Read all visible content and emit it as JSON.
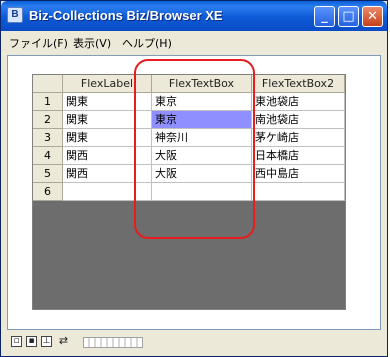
{
  "window": {
    "title": "Biz-Collections Biz/Browser XE",
    "app_icon_glyph": "B",
    "icon": "app-window-icon",
    "buttons": {
      "minimize": "_",
      "maximize": "□",
      "close": "✕"
    }
  },
  "menu": {
    "items": [
      "ファイル(F)",
      "表示(V)",
      "ヘルプ(H)"
    ]
  },
  "grid": {
    "columns": [
      "",
      "FlexLabel",
      "FlexTextBox",
      "FlexTextBox2"
    ],
    "rows": [
      {
        "num": "1",
        "label": "関東",
        "text": "東京",
        "text2": "東池袋店"
      },
      {
        "num": "2",
        "label": "関東",
        "text": "東京",
        "text2": "南池袋店"
      },
      {
        "num": "3",
        "label": "関東",
        "text": "神奈川",
        "text2": "茅ケ崎店"
      },
      {
        "num": "4",
        "label": "関西",
        "text": "大阪",
        "text2": "日本橋店"
      },
      {
        "num": "5",
        "label": "関西",
        "text": "大阪",
        "text2": "西中島店"
      },
      {
        "num": "6",
        "label": "",
        "text": "",
        "text2": ""
      }
    ],
    "selected_cell": {
      "row": 2,
      "column": "FlexTextBox"
    },
    "colors": {
      "selection": "#8f8fff",
      "empty_area": "#6d6d6d",
      "annotation": "#e81c1c"
    }
  },
  "statusbar": {
    "icons": [
      "window-icon",
      "save-icon",
      "print-icon",
      "connection-icon"
    ]
  }
}
